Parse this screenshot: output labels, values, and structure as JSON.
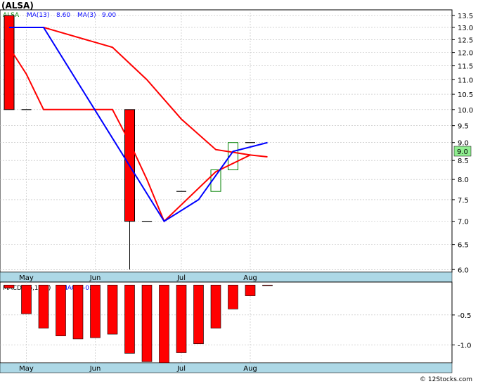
{
  "header": {
    "title": "(ALSA)",
    "ticker_label": "ALSA",
    "ma_long_label": "MA(13)",
    "ma_long_value": "8.60",
    "ma_short_label": "MA(3)",
    "ma_short_value": "9.00",
    "macd_label": "MACD(26,12,9)",
    "macd_value_label": "MACD:-0.01",
    "last_price_tag": "9.0"
  },
  "footer": {
    "credit": "© 12Stocks.com"
  },
  "colors": {
    "bullish": "#008000",
    "bearish": "#ff0000",
    "ma_long": "#ff0000",
    "ma_short": "#0000ff",
    "macd_bar": "#ff0000",
    "axis_band": "#add8e6",
    "price_tag_bg": "#90ee90",
    "grid": "#bbbbbb"
  },
  "chart_data": [
    {
      "type": "candlestick",
      "y_ticks": [
        "6.0",
        "6.5",
        "7.0",
        "7.5",
        "8.0",
        "8.5",
        "9.0",
        "9.5",
        "10.0",
        "10.5",
        "11.0",
        "11.5",
        "12.0",
        "12.5",
        "13.0",
        "13.5"
      ],
      "x_labels": [
        "May",
        "Jun",
        "Jul",
        "Aug"
      ],
      "x_label_weeks": [
        1.0,
        5.0,
        10.0,
        14.0
      ],
      "ylim": [
        5.95,
        13.75
      ],
      "log_scale": true,
      "weeks": 16,
      "candles": [
        {
          "w": 0,
          "o": 13.5,
          "h": 13.5,
          "l": 10.0,
          "c": 10.0
        },
        {
          "w": 1,
          "o": 10.0,
          "h": 10.0,
          "l": 10.0,
          "c": 10.0
        },
        {
          "w": 7,
          "o": 10.0,
          "h": 10.0,
          "l": 6.0,
          "c": 7.0
        },
        {
          "w": 8,
          "o": 7.0,
          "h": 7.0,
          "l": 7.0,
          "c": 7.0
        },
        {
          "w": 10,
          "o": 7.7,
          "h": 7.7,
          "l": 7.7,
          "c": 7.7
        },
        {
          "w": 12,
          "o": 7.7,
          "h": 8.25,
          "l": 7.7,
          "c": 8.25
        },
        {
          "w": 13,
          "o": 8.25,
          "h": 9.0,
          "l": 8.25,
          "c": 9.0
        },
        {
          "w": 14,
          "o": 9.0,
          "h": 9.0,
          "l": 9.0,
          "c": 9.0
        }
      ],
      "ma13": [
        [
          0,
          12.2
        ],
        [
          1,
          11.2
        ],
        [
          2,
          10.0
        ],
        [
          6,
          10.0
        ],
        [
          7,
          9.0
        ],
        [
          8,
          8.0
        ],
        [
          9,
          7.0
        ],
        [
          12,
          8.2
        ],
        [
          14,
          8.65
        ],
        [
          15,
          8.6
        ]
      ],
      "ma13_upper": [
        [
          2,
          13.0
        ],
        [
          6,
          12.2
        ],
        [
          8,
          11.0
        ],
        [
          10,
          9.7
        ],
        [
          12,
          8.8
        ],
        [
          14,
          8.65
        ]
      ],
      "ma3": [
        [
          0,
          13.0
        ],
        [
          2,
          13.0
        ],
        [
          9,
          7.0
        ],
        [
          11,
          7.5
        ],
        [
          13,
          8.75
        ],
        [
          15,
          9.0
        ]
      ]
    },
    {
      "type": "bar",
      "name": "MACD(26,12,9)",
      "y_ticks": [
        "-1.0",
        "-0.5"
      ],
      "ylim": [
        -1.3,
        0.05
      ],
      "weeks": [
        0,
        1,
        2,
        3,
        4,
        5,
        6,
        7,
        8,
        9,
        10,
        11,
        12,
        13,
        14,
        15
      ],
      "values": [
        -0.05,
        -0.48,
        -0.72,
        -0.85,
        -0.9,
        -0.88,
        -0.82,
        -1.14,
        -1.28,
        -1.3,
        -1.13,
        -0.98,
        -0.72,
        -0.4,
        -0.18,
        -0.01
      ]
    }
  ]
}
